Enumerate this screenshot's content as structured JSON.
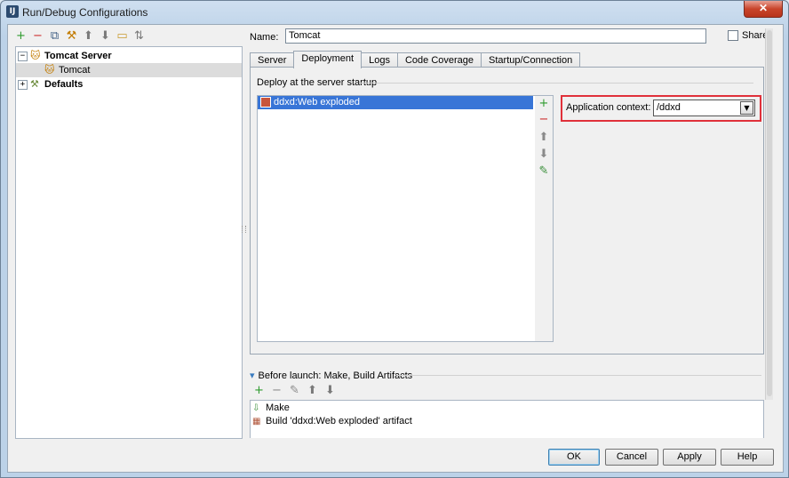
{
  "window": {
    "title": "Run/Debug Configurations",
    "app_icon": "IJ",
    "close_label": "✕"
  },
  "toolbar": {
    "icons": [
      {
        "name": "add-icon",
        "glyph": "+",
        "color": "#2e9b2e"
      },
      {
        "name": "remove-icon",
        "glyph": "−",
        "color": "#cc2a2a"
      },
      {
        "name": "copy-icon",
        "glyph": "⧉",
        "color": "#3c5b82"
      },
      {
        "name": "wrench-icon",
        "glyph": "⚒",
        "color": "#c27b00"
      },
      {
        "name": "move-up-icon",
        "glyph": "⬆",
        "color": "#7a7a7a"
      },
      {
        "name": "move-down-icon",
        "glyph": "⬇",
        "color": "#7a7a7a"
      },
      {
        "name": "folder-icon",
        "glyph": "▭",
        "color": "#c99a2e"
      },
      {
        "name": "sort-icon",
        "glyph": "⇅",
        "color": "#7a7a7a"
      }
    ]
  },
  "tree": {
    "server_group": "Tomcat Server",
    "server_item": "Tomcat",
    "defaults": "Defaults",
    "expanded_glyph": "−",
    "collapsed_glyph": "+"
  },
  "config": {
    "name_label": "Name:",
    "name_value": "Tomcat",
    "share_label": "Share"
  },
  "tabs": [
    "Server",
    "Deployment",
    "Logs",
    "Code Coverage",
    "Startup/Connection"
  ],
  "active_tab_index": 1,
  "deployment": {
    "group_label": "Deploy at the server startup",
    "items": [
      "ddxd:Web exploded"
    ],
    "side_buttons": [
      {
        "name": "add-artifact-icon",
        "glyph": "+",
        "color": "#2e9b2e"
      },
      {
        "name": "remove-artifact-icon",
        "glyph": "−",
        "color": "#cc2a2a"
      },
      {
        "name": "move-up-icon",
        "glyph": "⬆",
        "color": "#8a8a8a"
      },
      {
        "name": "move-down-icon",
        "glyph": "⬇",
        "color": "#8a8a8a"
      },
      {
        "name": "edit-pencil-icon",
        "glyph": "✎",
        "color": "#3a8f3a"
      }
    ],
    "context_label": "Application context:",
    "context_value": "/ddxd",
    "highlight_color": "#e0303a"
  },
  "before_launch": {
    "title": "Before launch: Make, Build Artifacts",
    "collapse_glyph": "▾",
    "toolbar_icons": [
      {
        "name": "add-icon",
        "glyph": "+",
        "color": "#2e9b2e"
      },
      {
        "name": "remove-icon",
        "glyph": "−",
        "color": "#8a8a8a"
      },
      {
        "name": "edit-pencil-icon",
        "glyph": "✎",
        "color": "#8a8a8a"
      },
      {
        "name": "move-up-icon",
        "glyph": "⬆",
        "color": "#7a7a7a"
      },
      {
        "name": "move-down-icon",
        "glyph": "⬇",
        "color": "#7a7a7a"
      }
    ],
    "items": [
      {
        "icon": "make-icon",
        "glyph": "⇩",
        "label": "Make"
      },
      {
        "icon": "build-artifact-icon",
        "glyph": "▦",
        "label": "Build 'ddxd:Web exploded' artifact"
      }
    ]
  },
  "footer": {
    "ok": "OK",
    "cancel": "Cancel",
    "apply": "Apply",
    "help": "Help"
  }
}
